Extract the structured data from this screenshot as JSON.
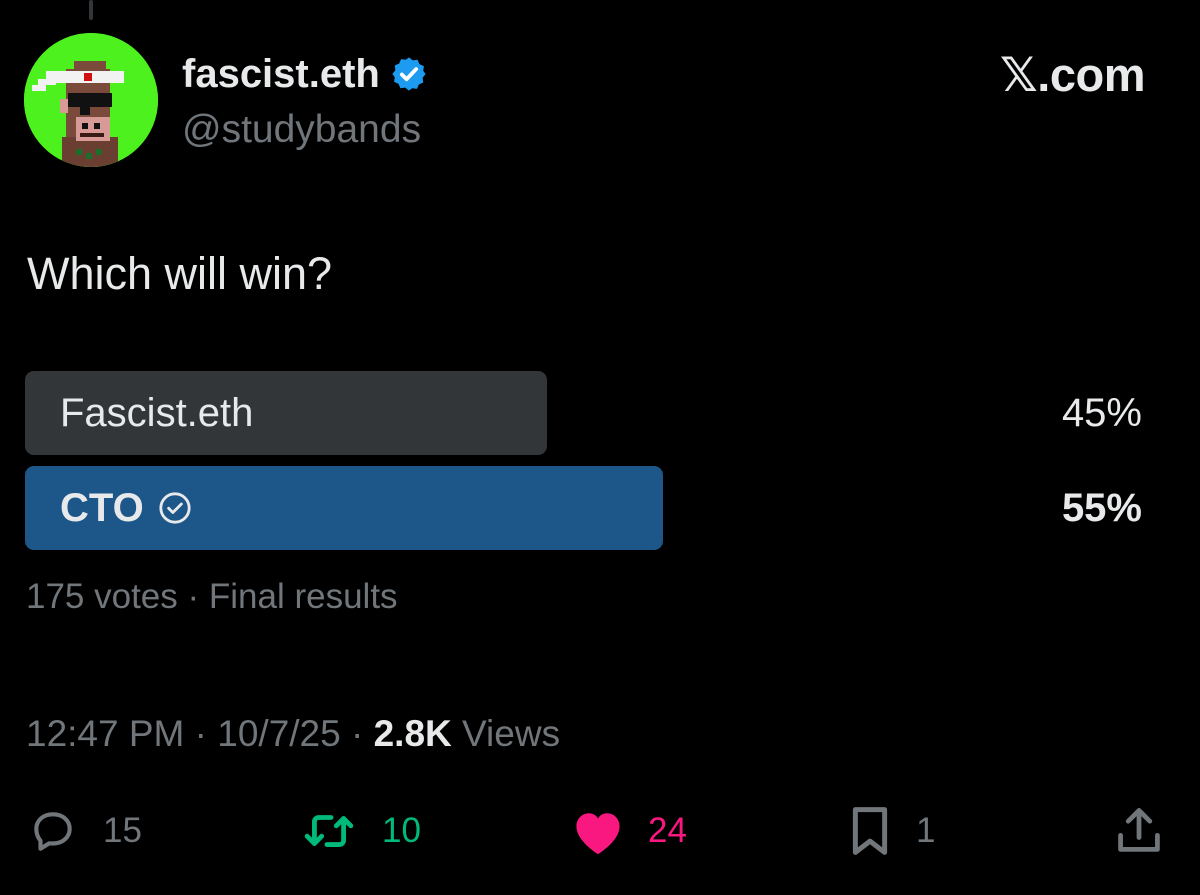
{
  "header": {
    "display_name": "fascist.eth",
    "handle": "@studybands",
    "brand": "𝕏.com",
    "verified": true
  },
  "tweet": {
    "text": "Which will win?"
  },
  "poll": {
    "options": [
      {
        "label": "Fascist.eth",
        "percent_label": "45%",
        "percent": 45,
        "winner": false
      },
      {
        "label": "CTO",
        "percent_label": "55%",
        "percent": 55,
        "winner": true
      }
    ],
    "meta": "175 votes · Final results"
  },
  "timestamp": {
    "time": "12:47 PM",
    "sep1": "·",
    "date": "10/7/25",
    "sep2": "·",
    "views_count": "2.8K",
    "views_label": "Views"
  },
  "actions": {
    "replies": "15",
    "reposts": "10",
    "likes": "24",
    "bookmarks": "1"
  },
  "colors": {
    "background": "#000000",
    "text": "#e7e9ea",
    "muted": "#71767b",
    "poll_bar": "#333639",
    "poll_winner": "#1d5689",
    "verified_blue": "#1d9bf0",
    "repost_green": "#00ba7c",
    "like_pink": "#f91880",
    "avatar_bg": "#4df21e"
  },
  "icons": {
    "verified": "verified-badge-icon",
    "winner": "check-circle-icon",
    "reply": "reply-icon",
    "repost": "repost-icon",
    "like": "heart-icon",
    "bookmark": "bookmark-icon",
    "share": "share-icon"
  }
}
